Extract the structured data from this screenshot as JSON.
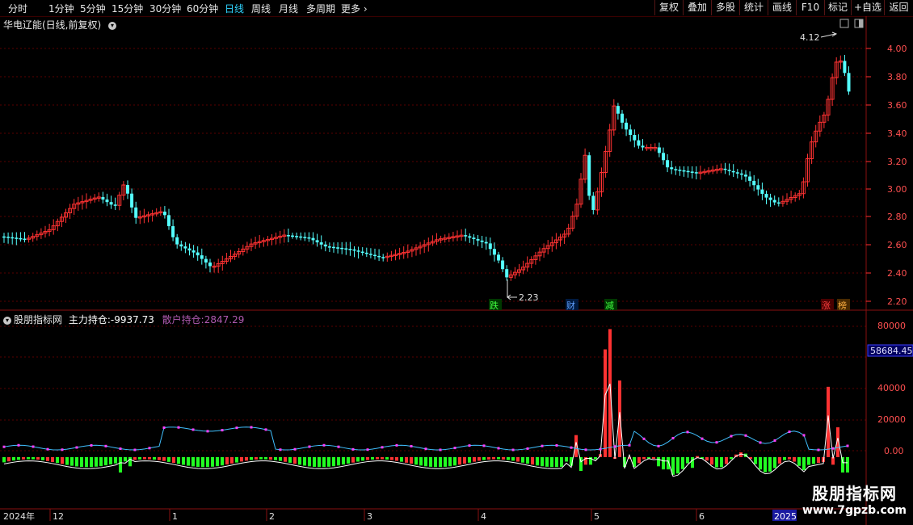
{
  "toolbar": {
    "periods": [
      "分时",
      "1分钟",
      "5分钟",
      "15分钟",
      "30分钟",
      "60分钟",
      "日线",
      "周线",
      "月线",
      "多周期",
      "更多"
    ],
    "active": "日线",
    "right_buttons": [
      "复权",
      "叠加",
      "多股",
      "统计",
      "画线",
      "F10",
      "标记",
      "+自选",
      "返回"
    ]
  },
  "title": "华电辽能(日线,前复权)",
  "price_axis": [
    "4.00",
    "3.80",
    "3.60",
    "3.40",
    "3.20",
    "3.00",
    "2.80",
    "2.60",
    "2.40",
    "2.20"
  ],
  "annotations": {
    "high": "4.12",
    "low": "2.23"
  },
  "event_labels": [
    "跌",
    "财",
    "减",
    "涨",
    "榜"
  ],
  "colors": {
    "up": "#ff3232",
    "down": "#54ffff",
    "main_line": "#ffffff",
    "retail_line": "#ff40ff",
    "bg": "#000000",
    "grid": "#5a0000"
  },
  "indicator": {
    "name": "股朋指标网",
    "main_label": "主力持仓:",
    "main_value": "-9937.73",
    "retail_label": "散户持仓:",
    "retail_value": "2847.29",
    "axis": [
      "80000",
      "60000",
      "40000",
      "20000",
      "0.00"
    ],
    "current_marker": "58684.45"
  },
  "date_axis": [
    "2024年",
    "12",
    "1",
    "2",
    "3",
    "4",
    "5",
    "6",
    "2025"
  ],
  "watermark": {
    "title": "股朋指标网",
    "url": "www.7gpzb.com"
  }
}
